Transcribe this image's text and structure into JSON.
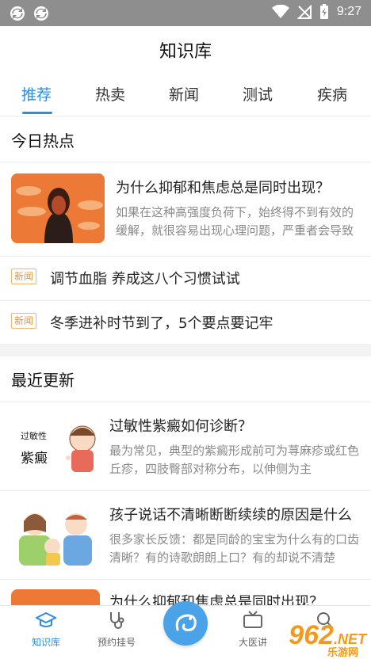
{
  "status_bar": {
    "time": "9:27"
  },
  "header": {
    "title": "知识库"
  },
  "tabs": [
    {
      "label": "推荐",
      "active": true
    },
    {
      "label": "热卖",
      "active": false
    },
    {
      "label": "新闻",
      "active": false
    },
    {
      "label": "测试",
      "active": false
    },
    {
      "label": "疾病",
      "active": false
    }
  ],
  "today_hot": {
    "title": "今日热点",
    "featured": {
      "title": "为什么抑郁和焦虑总是同时出现？",
      "desc": "如果在这种高强度负荷下，始终得不到有效的缓解，就很容易出现心理问题，严重者会导致抑郁、焦虑等症状"
    },
    "news": [
      {
        "badge": "新闻",
        "text": "调节血脂 养成这八个习惯试试"
      },
      {
        "badge": "新闻",
        "text": "冬季进补时节到了，5个要点要记牢"
      }
    ]
  },
  "recent": {
    "title": "最近更新",
    "items": [
      {
        "title": "过敏性紫癜如何诊断？",
        "desc": "最为常见，典型的紫癜形成前可为荨麻疹或红色丘疹，四肢臀部对称分布，以伸侧为主",
        "thumb_text_top": "过敏性",
        "thumb_text_bottom": "紫癜"
      },
      {
        "title": "孩子说话不清晰断断续续的原因是什么",
        "desc": "很多家长反馈：都是同龄的宝宝为什么有的口齿清晰？有的诗歌朗朗上口？有的却说不清楚"
      },
      {
        "title": "为什么抑郁和焦虑总是同时出现？",
        "desc": ""
      }
    ]
  },
  "bottom_nav": [
    {
      "label": "知识库",
      "icon": "graduation-cap-icon",
      "active": true
    },
    {
      "label": "预约挂号",
      "icon": "stethoscope-icon",
      "active": false
    },
    {
      "label": "",
      "icon": "center-logo-icon",
      "active": false
    },
    {
      "label": "大医讲",
      "icon": "tv-icon",
      "active": false
    },
    {
      "label": "",
      "icon": "search-icon",
      "active": false
    }
  ],
  "watermark": {
    "text": "962",
    "suffix": ".NET",
    "sub": "乐游网"
  },
  "colors": {
    "accent": "#2f8de0",
    "badge": "#e49a30",
    "statusbar": "#8e8e8e"
  }
}
